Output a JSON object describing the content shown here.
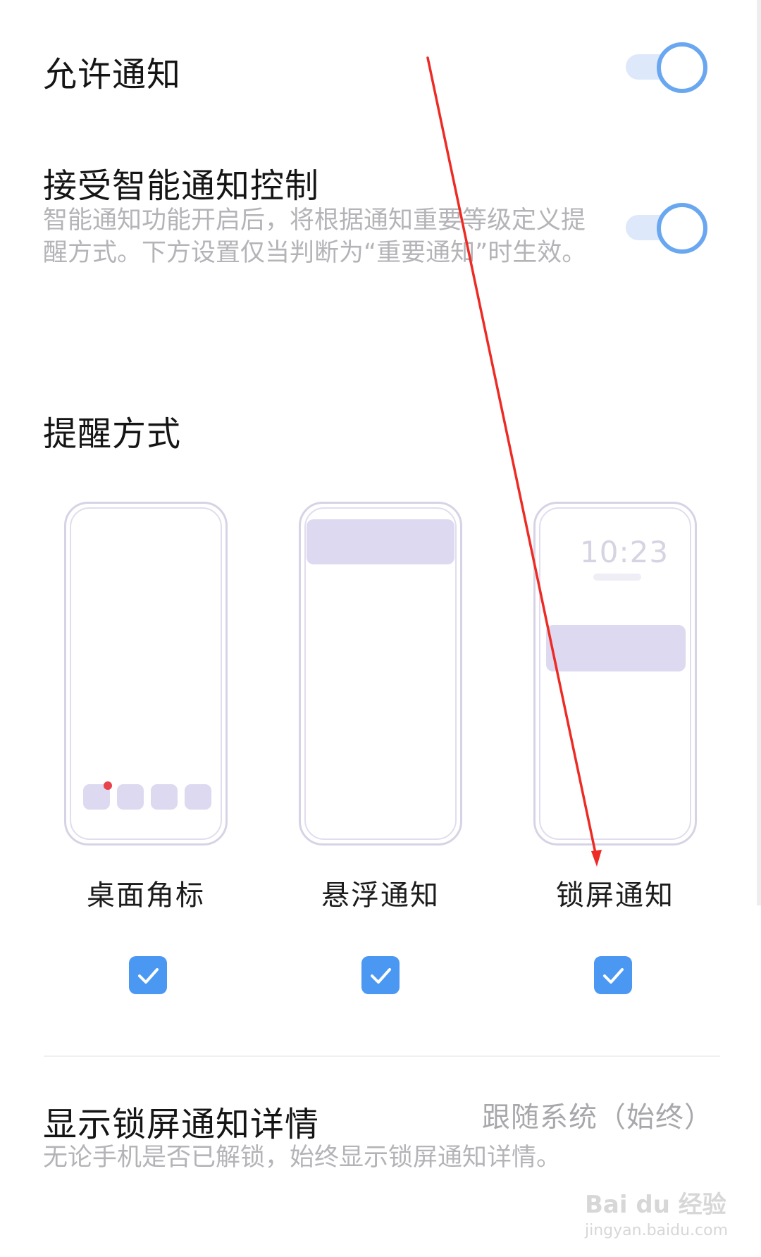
{
  "allow_notifications": {
    "label": "允许通知",
    "enabled": true
  },
  "smart_control": {
    "label": "接受智能通知控制",
    "description": "智能通知功能开启后，将根据通知重要等级定义提醒方式。下方设置仅当判断为“重要通知”时生效。",
    "enabled": true
  },
  "reminder": {
    "section_title": "提醒方式",
    "options": [
      {
        "label": "桌面角标",
        "checked": true
      },
      {
        "label": "悬浮通知",
        "checked": true
      },
      {
        "label": "锁屏通知",
        "checked": true
      }
    ],
    "lockscreen_preview_time": "10:23"
  },
  "lockscreen_details": {
    "label": "显示锁屏通知详情",
    "value": "跟随系统（始终）",
    "description": "无论手机是否已解锁，始终显示锁屏通知详情。"
  },
  "watermark": {
    "brand": "Bai du 经验",
    "url": "jingyan.baidu.com"
  },
  "colors": {
    "accent": "#4b98f3",
    "toggle_ring": "#6aa7f1",
    "annotation_arrow": "#ee2a24",
    "badge": "#e8434c"
  }
}
